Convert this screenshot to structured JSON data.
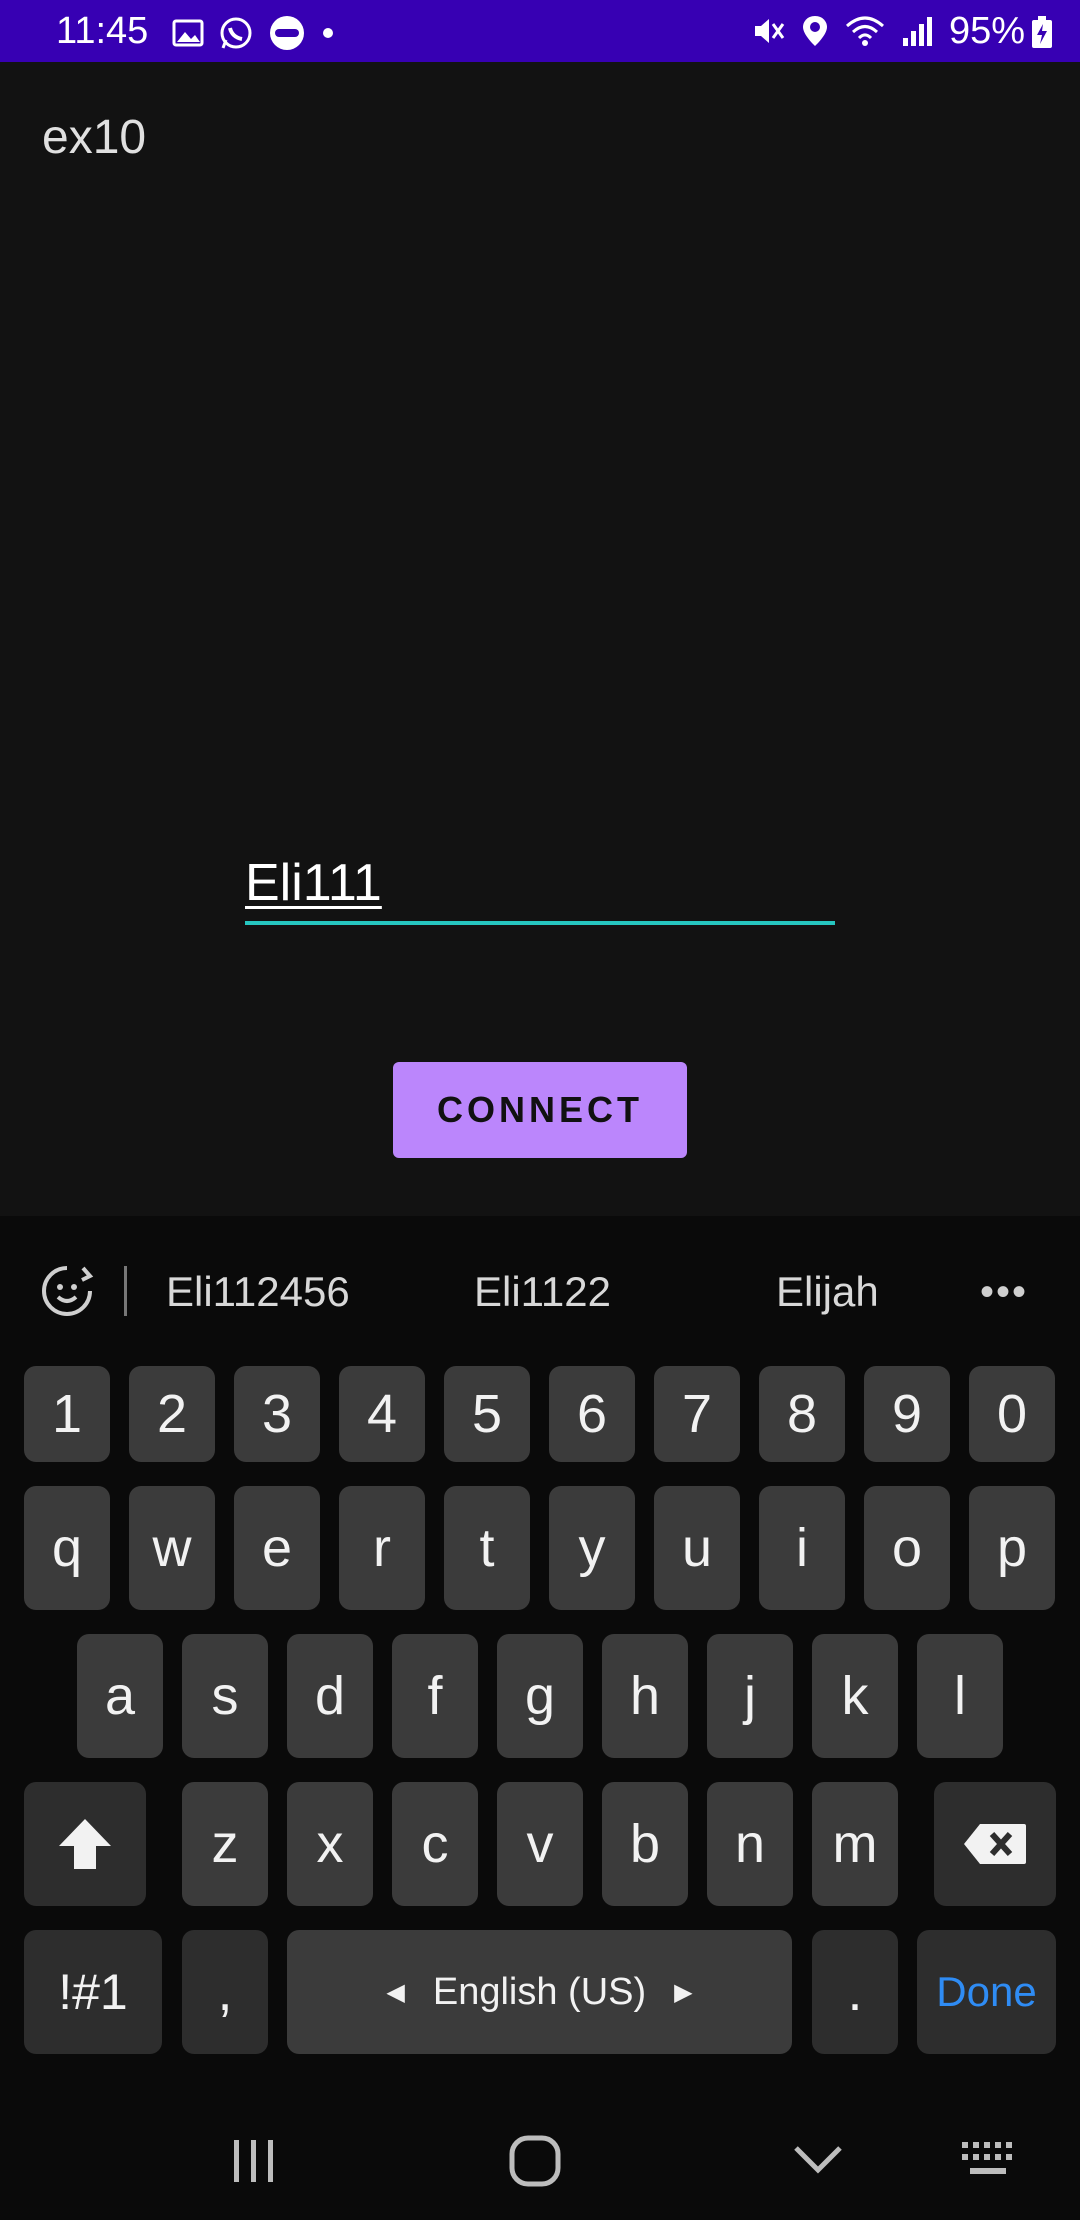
{
  "status_bar": {
    "time": "11:45",
    "battery": "95%",
    "left_icons": [
      "gallery-icon",
      "whatsapp-icon",
      "app-365-icon",
      "dot-icon"
    ],
    "right_icons": [
      "mute-icon",
      "location-icon",
      "wifi-icon",
      "signal-icon",
      "battery-charging-icon"
    ]
  },
  "app": {
    "title": "ex10",
    "name_field_value": "Eli111",
    "connect_label": "CONNECT",
    "accent_color": "#bb86fc",
    "field_underline_color": "#26c6c0"
  },
  "keyboard": {
    "suggestions": [
      "Eli112456",
      "Eli1122",
      "Elijah"
    ],
    "more": "•••",
    "row_numbers": [
      "1",
      "2",
      "3",
      "4",
      "5",
      "6",
      "7",
      "8",
      "9",
      "0"
    ],
    "row_q": [
      "q",
      "w",
      "e",
      "r",
      "t",
      "y",
      "u",
      "i",
      "o",
      "p"
    ],
    "row_a": [
      "a",
      "s",
      "d",
      "f",
      "g",
      "h",
      "j",
      "k",
      "l"
    ],
    "row_z": [
      "z",
      "x",
      "c",
      "v",
      "b",
      "n",
      "m"
    ],
    "symbols_label": "!#1",
    "comma_label": ",",
    "space_label": "English (US)",
    "period_label": ".",
    "done_label": "Done"
  },
  "nav_bar": {
    "icons": [
      "recent-apps-icon",
      "home-icon",
      "back-icon",
      "keyboard-switch-icon"
    ]
  }
}
